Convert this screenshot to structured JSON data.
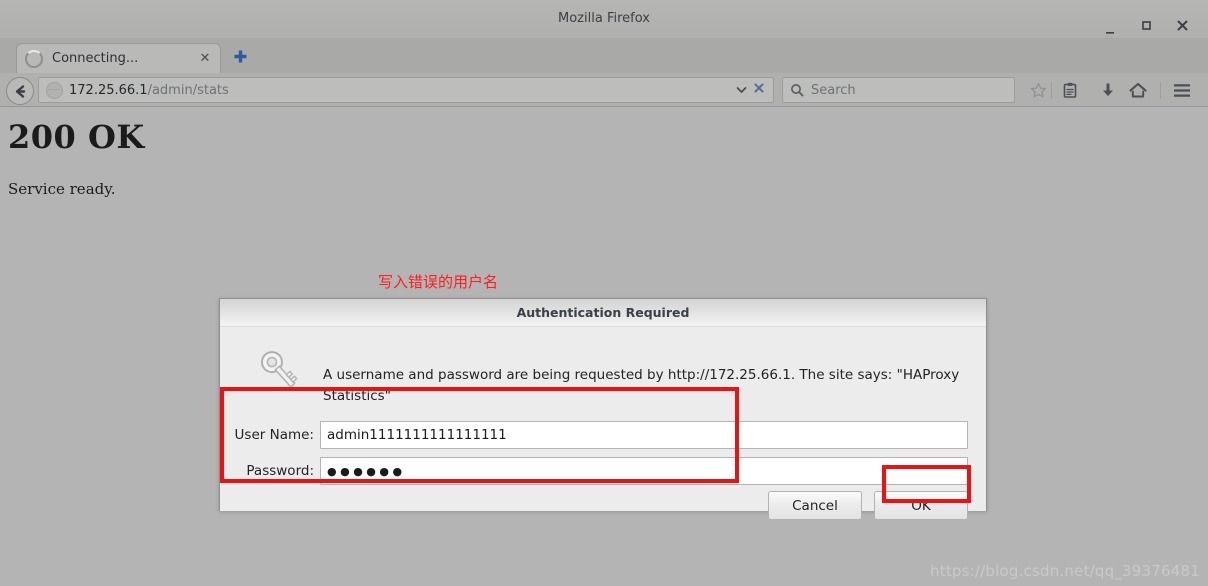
{
  "window": {
    "title": "Mozilla Firefox",
    "controls": {
      "minimize": "–",
      "maximize": "□",
      "close": "✕"
    }
  },
  "tabs": {
    "items": [
      {
        "label": "Connecting...",
        "close": "✕",
        "icon": "loading-spinner-icon"
      }
    ],
    "new_tab_label": "+"
  },
  "toolbar": {
    "back_icon": "←",
    "url": {
      "host": "172.25.66.1",
      "path": "/admin/stats",
      "dropdown_icon": "⌄",
      "stop_icon": "✕"
    },
    "search": {
      "placeholder": "Search",
      "icon": "search-icon"
    },
    "buttons": [
      {
        "name": "bookmark-star-button",
        "icon": "star-icon"
      },
      {
        "name": "reader-list-button",
        "icon": "clipboard-icon"
      },
      {
        "name": "downloads-button",
        "icon": "download-arrow-icon"
      },
      {
        "name": "home-button",
        "icon": "home-icon"
      },
      {
        "name": "menu-button",
        "icon": "hamburger-icon"
      }
    ]
  },
  "page": {
    "heading": "200 OK",
    "body": "Service ready."
  },
  "annotation": {
    "text": "写入错误的用户名",
    "color": "#fc1d1d"
  },
  "dialog": {
    "title": "Authentication Required",
    "icon": "key-icon",
    "message": "A username and password are being requested by http://172.25.66.1. The site says: \"HAProxy Statistics\"",
    "fields": [
      {
        "label": "User Name:",
        "value": "admin1111111111111111",
        "type": "text"
      },
      {
        "label": "Password:",
        "value": "●●●●●●",
        "type": "password"
      }
    ],
    "buttons": [
      {
        "name": "cancel-button",
        "label": "Cancel"
      },
      {
        "name": "ok-button",
        "label": "OK"
      }
    ]
  },
  "highlights": {
    "color": "#ee1111",
    "fields_box": "credentials-fields-highlight",
    "ok_box": "ok-button-highlight"
  },
  "watermark": "https://blog.csdn.net/qq_39376481"
}
